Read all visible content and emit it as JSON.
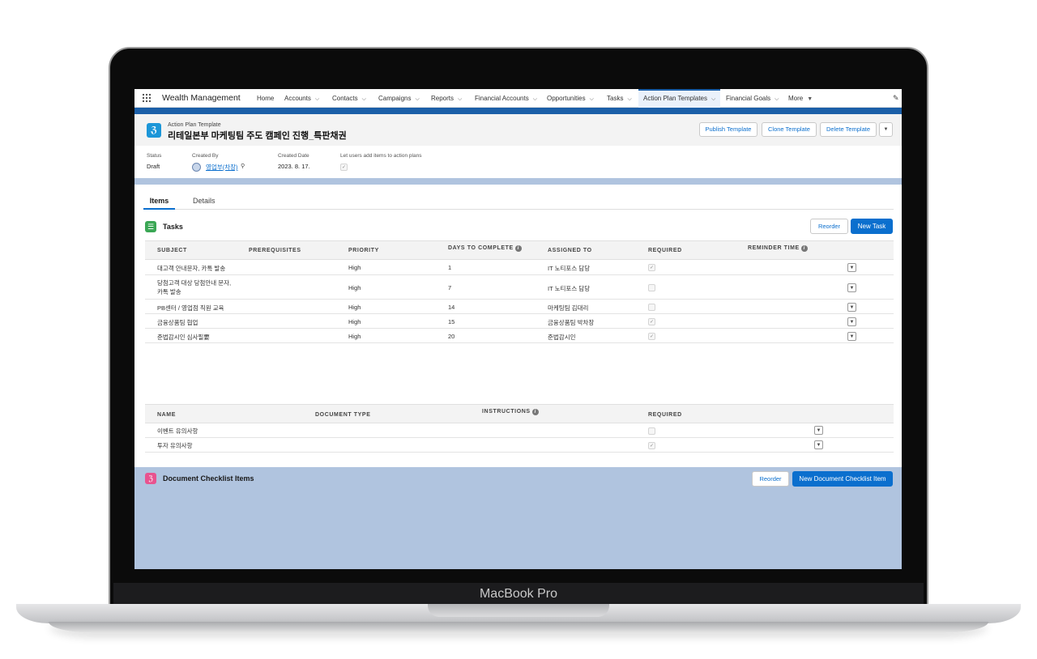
{
  "device": {
    "brand": "MacBook Pro"
  },
  "nav": {
    "app_name": "Wealth Management",
    "items": [
      {
        "label": "Home"
      },
      {
        "label": "Accounts"
      },
      {
        "label": "Contacts"
      },
      {
        "label": "Campaigns"
      },
      {
        "label": "Reports"
      },
      {
        "label": "Financial Accounts"
      },
      {
        "label": "Opportunities"
      },
      {
        "label": "Tasks"
      },
      {
        "label": "Action Plan Templates"
      },
      {
        "label": "Financial Goals"
      },
      {
        "label": "More"
      }
    ]
  },
  "header": {
    "object_type": "Action Plan Template",
    "title": "리테일본부 마케팅팀 주도 캠페인 진행_특판채권",
    "buttons": {
      "publish": "Publish Template",
      "clone": "Clone Template",
      "delete": "Delete Template"
    }
  },
  "highlights": {
    "status_label": "Status",
    "status": "Draft",
    "created_by_label": "Created By",
    "created_by": "영업부(차장)",
    "created_date_label": "Created Date",
    "created_date": "2023. 8. 17.",
    "let_users_label": "Let users add items to action plans",
    "let_users_checked": true
  },
  "tabs": [
    {
      "label": "Items",
      "active": true
    },
    {
      "label": "Details",
      "active": false
    }
  ],
  "tasks": {
    "title": "Tasks",
    "reorder": "Reorder",
    "new": "New Task",
    "columns": [
      "SUBJECT",
      "PREREQUISITES",
      "PRIORITY",
      "DAYS TO COMPLETE",
      "ASSIGNED TO",
      "REQUIRED",
      "REMINDER TIME"
    ],
    "rows": [
      {
        "subject": "대고객 안내문자, 카톡 발송",
        "priority": "High",
        "days": "1",
        "assigned": "IT 노티포스 담당",
        "required": true
      },
      {
        "subject": "당첨고객 대상 당첨안내 문자,",
        "subject2": "카톡 발송",
        "priority": "High",
        "days": "7",
        "assigned": "IT 노티포스 담당",
        "required": false
      },
      {
        "subject": "PB센터 / 영업점 직원 교육",
        "priority": "High",
        "days": "14",
        "assigned": "마케팅팀 김대리",
        "required": false
      },
      {
        "subject": "금융상품팀 협업",
        "priority": "High",
        "days": "15",
        "assigned": "금융상품팀 박차장",
        "required": true
      },
      {
        "subject": "준법감시인 심사필要",
        "priority": "High",
        "days": "20",
        "assigned": "준법감시인",
        "required": true
      }
    ]
  },
  "docs": {
    "title": "Document Checklist Items",
    "reorder": "Reorder",
    "new": "New Document Checklist Item",
    "columns": [
      "NAME",
      "DOCUMENT TYPE",
      "INSTRUCTIONS",
      "REQUIRED"
    ],
    "rows": [
      {
        "name": "이벤트 유의사항",
        "required": false
      },
      {
        "name": "투자 유의사항",
        "required": true
      }
    ]
  },
  "colors": {
    "brand": "#0b6fce",
    "band": "#1b5fa8",
    "backdrop": "#b0c4df"
  }
}
